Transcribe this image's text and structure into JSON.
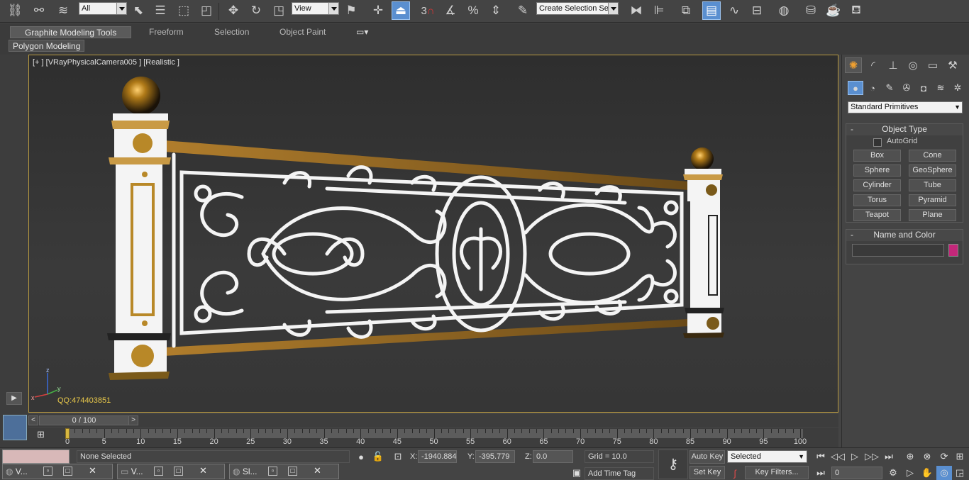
{
  "toolbar": {
    "selection_filter": "All",
    "ref_coord": "View",
    "named_selection": "Create Selection Se",
    "snap_3": "3"
  },
  "ribbon": {
    "tabs": [
      "Graphite Modeling Tools",
      "Freeform",
      "Selection",
      "Object Paint"
    ],
    "panel": "Polygon Modeling"
  },
  "viewport": {
    "label": "[+ ] [VRayPhysicalCamera005 ] [Realistic ]",
    "watermark": "QQ:474403851",
    "axis": {
      "x": "x",
      "y": "y",
      "z": "z"
    }
  },
  "command_panel": {
    "primitive_type": "Standard Primitives",
    "object_type": {
      "title": "Object Type",
      "autogrid": "AutoGrid",
      "buttons": [
        "Box",
        "Cone",
        "Sphere",
        "GeoSphere",
        "Cylinder",
        "Tube",
        "Torus",
        "Pyramid",
        "Teapot",
        "Plane"
      ]
    },
    "name_color": {
      "title": "Name and Color",
      "color": "#c4277a"
    }
  },
  "time": {
    "frame": "0 / 100",
    "ticks": [
      "0",
      "5",
      "10",
      "15",
      "20",
      "25",
      "30",
      "35",
      "40",
      "45",
      "50",
      "55",
      "60",
      "65",
      "70",
      "75",
      "80",
      "85",
      "90",
      "95",
      "100"
    ]
  },
  "status": {
    "selection": "None Selected",
    "x_label": "X:",
    "x_value": "-1940.884",
    "y_label": "Y:",
    "y_value": "-395.779",
    "z_label": "Z:",
    "z_value": "0.0",
    "grid": "Grid = 10.0",
    "add_time_tag": "Add Time Tag",
    "auto_key": "Auto Key",
    "set_key": "Set Key",
    "key_mode": "Selected",
    "key_filters": "Key Filters...",
    "frame_field": "0"
  },
  "taskbar": {
    "tasks": [
      "V...",
      "V...",
      "Sl..."
    ]
  }
}
